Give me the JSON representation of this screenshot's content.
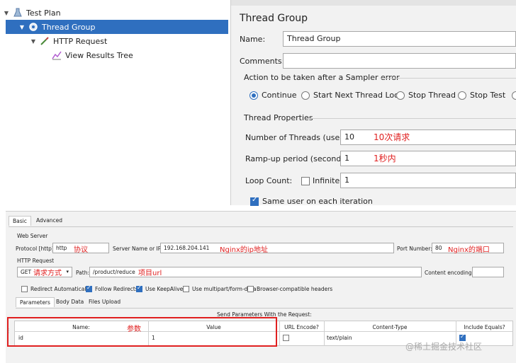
{
  "tree": {
    "items": [
      {
        "label": "Test Plan"
      },
      {
        "label": "Thread Group"
      },
      {
        "label": "HTTP Request"
      },
      {
        "label": "View Results Tree"
      }
    ]
  },
  "thread_group": {
    "title": "Thread Group",
    "name_label": "Name:",
    "name_value": "Thread Group",
    "comments_label": "Comments:",
    "comments_value": "",
    "error_section": "Action to be taken after a Sampler error",
    "error_options": [
      "Continue",
      "Start Next Thread Loop",
      "Stop Thread",
      "Stop Test"
    ],
    "error_selected": "Continue",
    "props_section": "Thread Properties",
    "threads_label": "Number of Threads (users):",
    "threads_value": "10",
    "threads_note": "10次请求",
    "rampup_label": "Ramp-up period (seconds):",
    "rampup_value": "1",
    "rampup_note": "1秒内",
    "loop_label": "Loop Count:",
    "infinite_label": "Infinite",
    "infinite_checked": false,
    "loop_value": "1",
    "same_user_label": "Same user on each iteration",
    "same_user_checked": true
  },
  "http_request": {
    "tabs": [
      "Basic",
      "Advanced"
    ],
    "active_tab": "Basic",
    "web_server_label": "Web Server",
    "protocol_label": "Protocol [http]:",
    "protocol_value": "http",
    "protocol_note": "协议",
    "server_label": "Server Name or IP:",
    "server_value": "192.168.204.141",
    "server_note": "Nginx的ip地址",
    "port_label": "Port Number:",
    "port_value": "80",
    "port_note": "Nginx的端口",
    "http_request_label": "HTTP Request",
    "method_value": "GET",
    "method_note": "请求方式",
    "path_label": "Path:",
    "path_value": "/product/reduce",
    "path_note": "项目url",
    "encoding_label": "Content encoding:",
    "encoding_value": "",
    "options": [
      {
        "label": "Redirect Automatically",
        "checked": false
      },
      {
        "label": "Follow Redirects",
        "checked": true
      },
      {
        "label": "Use KeepAlive",
        "checked": true
      },
      {
        "label": "Use multipart/form-data",
        "checked": false
      },
      {
        "label": "Browser-compatible headers",
        "checked": false
      }
    ],
    "sub_tabs": [
      "Parameters",
      "Body Data",
      "Files Upload"
    ],
    "active_sub_tab": "Parameters",
    "send_params_label": "Send Parameters With the Request:",
    "params_note": "参数",
    "columns": [
      "Name:",
      "Value",
      "URL Encode?",
      "Content-Type",
      "Include Equals?"
    ],
    "rows": [
      {
        "name": "id",
        "value": "1",
        "url_encode": false,
        "content_type": "text/plain",
        "include_equals": true
      }
    ]
  },
  "watermark": "@稀土掘金技术社区",
  "colors": {
    "accent": "#2f6fbf",
    "annotation": "#e02020",
    "highlight_box": "#e02020"
  }
}
